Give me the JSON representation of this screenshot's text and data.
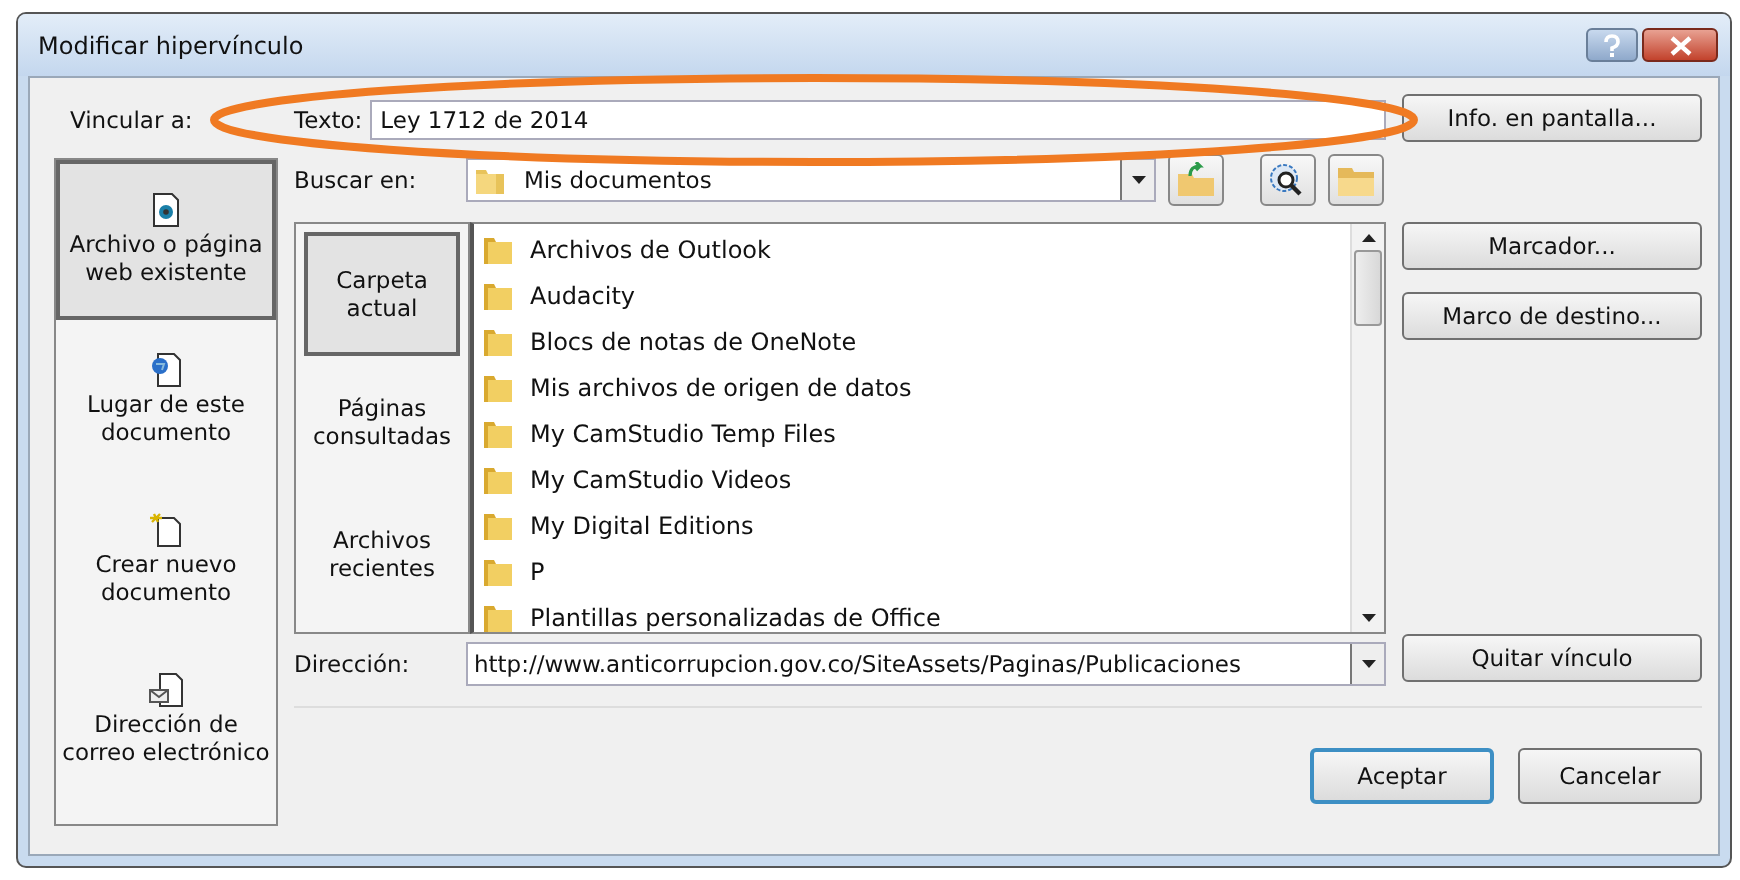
{
  "window": {
    "title": "Modificar hipervínculo"
  },
  "link_to": {
    "label": "Vincular a:",
    "items": [
      {
        "label": "Archivo o página web existente",
        "kind": "file",
        "selected": true
      },
      {
        "label": "Lugar de este documento",
        "kind": "place",
        "selected": false
      },
      {
        "label": "Crear nuevo documento",
        "kind": "new",
        "selected": false
      },
      {
        "label": "Dirección de correo electrónico",
        "kind": "email",
        "selected": false
      }
    ]
  },
  "text_field": {
    "label": "Texto:",
    "value": "Ley 1712 de 2014"
  },
  "screen_tip_button": "Info. en pantalla...",
  "look_in": {
    "label": "Buscar en:",
    "value": "Mis documentos"
  },
  "views": [
    {
      "label": "Carpeta actual",
      "selected": true
    },
    {
      "label": "Páginas consultadas",
      "selected": false
    },
    {
      "label": "Archivos recientes",
      "selected": false
    }
  ],
  "files": [
    "Archivos de Outlook",
    "Audacity",
    "Blocs de notas de OneNote",
    "Mis archivos de origen de datos",
    "My CamStudio Temp Files",
    "My CamStudio Videos",
    "My Digital Editions",
    "P",
    "Plantillas personalizadas de Office"
  ],
  "side_buttons": [
    "Marcador...",
    "Marco de destino..."
  ],
  "address": {
    "label": "Dirección:",
    "value": "http://www.anticorrupcion.gov.co/SiteAssets/Paginas/Publicaciones"
  },
  "remove_link_button": "Quitar vínculo",
  "buttons": [
    {
      "label": "Aceptar",
      "kind": "default"
    },
    {
      "label": "Cancelar",
      "kind": "normal"
    }
  ]
}
